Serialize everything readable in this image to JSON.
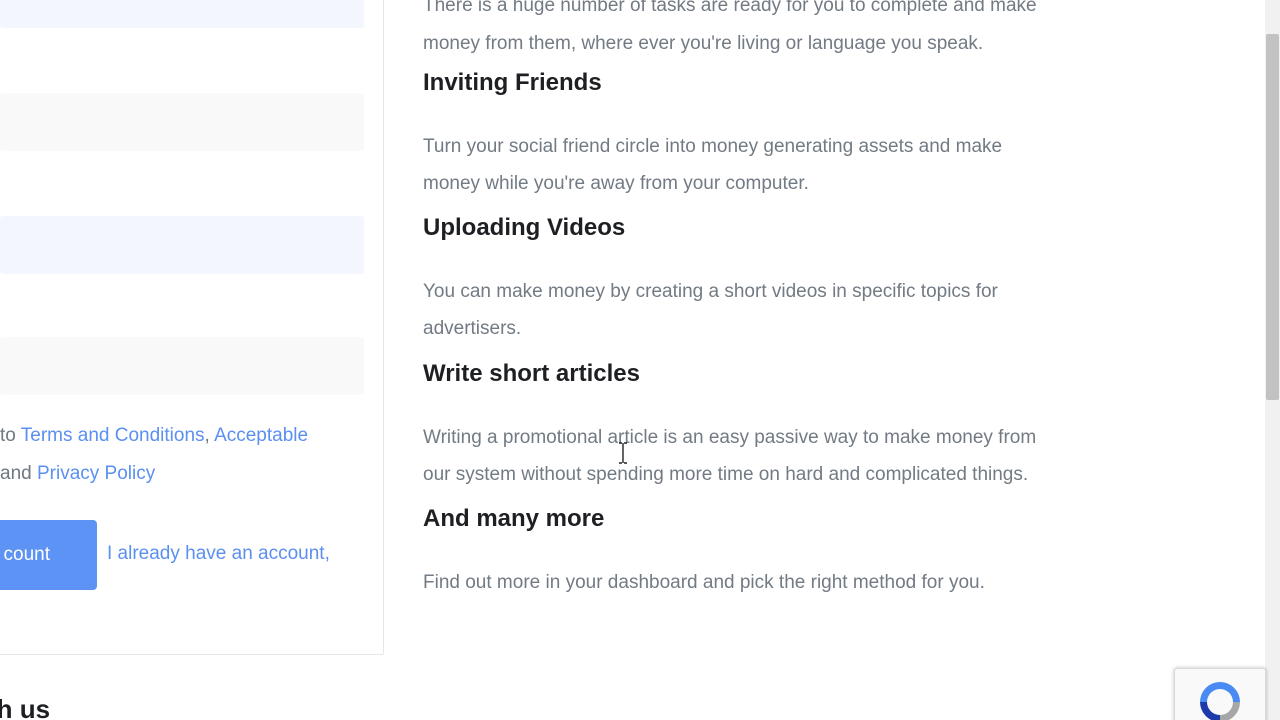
{
  "signup_form": {
    "terms_prefix": "to ",
    "terms_link": "Terms and Conditions",
    "terms_sep": ", ",
    "acceptable_link": "Acceptable",
    "and_word": "and ",
    "privacy_link": "Privacy Policy",
    "create_button_label": "count",
    "have_account_link": "I already have an account,"
  },
  "bottom_heading": "th us",
  "content": {
    "intro_cut_line": "There is a huge number of tasks are ready for you to complete and make",
    "intro_line_2": "money from them, where ever you're living or language you speak.",
    "sections": [
      {
        "title": "Inviting Friends",
        "desc_1": "Turn your social friend circle into money generating assets and make",
        "desc_2": "money while you're away from your computer."
      },
      {
        "title": "Uploading Videos",
        "desc_1": "You can make money by creating a short videos in specific topics for",
        "desc_2": "advertisers."
      },
      {
        "title": "Write short articles",
        "desc_1": "Writing a promotional article is an easy passive way to make money from",
        "desc_2": "our system without spending more time on hard and complicated things."
      },
      {
        "title": "And many more",
        "desc_1": "Find out more in your dashboard and pick the right method for you."
      }
    ]
  },
  "colors": {
    "accent": "#5c93f4",
    "link": "#5b8ff0",
    "heading": "#1d1f23",
    "body_text": "#727a84"
  },
  "icons": {
    "cursor": "text-cursor-icon",
    "recaptcha": "recaptcha-icon"
  }
}
